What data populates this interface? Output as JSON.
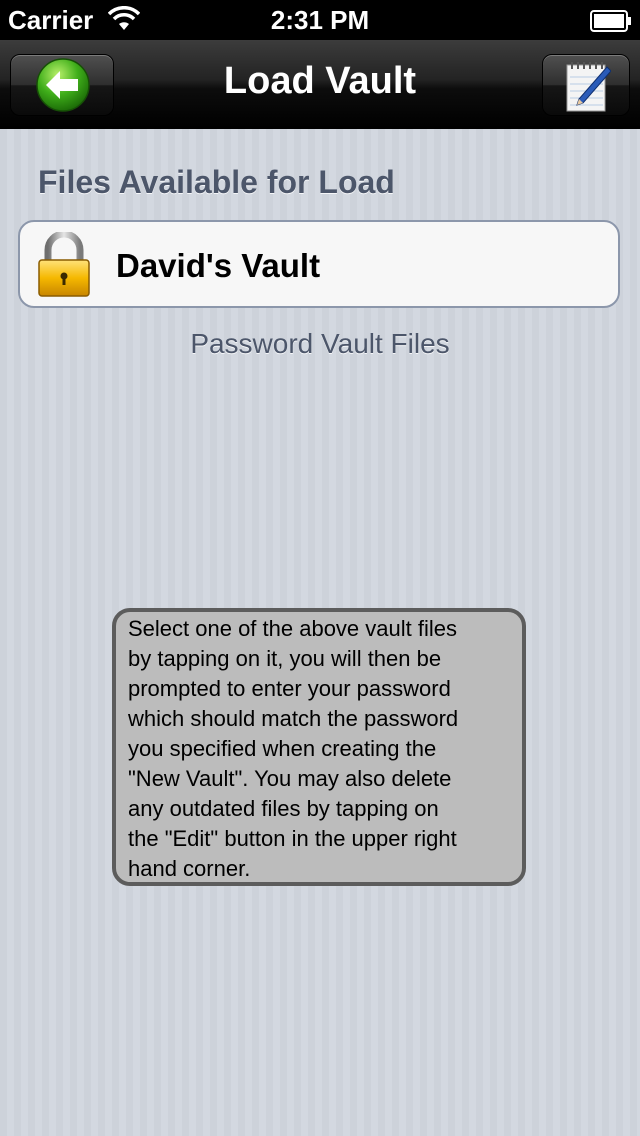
{
  "status_bar": {
    "carrier": "Carrier",
    "time": "2:31 PM"
  },
  "nav_bar": {
    "title": "Load Vault",
    "back_icon": "green-back-arrow-icon",
    "edit_icon": "notepad-pencil-icon"
  },
  "section": {
    "title": "Files Available for Load",
    "footer": "Password Vault Files",
    "files": [
      {
        "name": "David's Vault",
        "icon": "padlock-icon"
      }
    ]
  },
  "help": {
    "text": "Select one of the above vault files\nby tapping on it, you will then be\nprompted to enter your password\nwhich should match the password\nyou specified when creating the\n\"New Vault\".  You may also delete\nany outdated files by tapping on\nthe \"Edit\" button in the upper right\nhand corner."
  },
  "colors": {
    "section_text": "#4c566a",
    "row_border": "#8c97ab",
    "help_background": "#bcbcbc",
    "back_button_green": "#3fae1a"
  }
}
